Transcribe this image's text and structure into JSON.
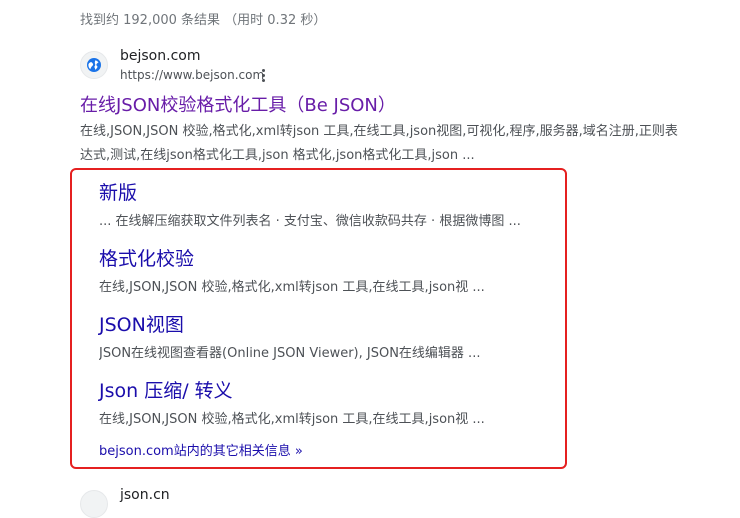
{
  "stats": "找到约 192,000 条结果 （用时 0.32 秒）",
  "result": {
    "site_name": "bejson.com",
    "url": "https://www.bejson.com",
    "favicon": "globe-icon",
    "title": "在线JSON校验格式化工具（Be JSON）",
    "snippet": "在线,JSON,JSON 校验,格式化,xml转json 工具,在线工具,json视图,可视化,程序,服务器,域名注册,正则表达式,测试,在线json格式化工具,json 格式化,json格式化工具,json ..."
  },
  "sitelinks": [
    {
      "title": "新版",
      "desc": "... 在线解压缩获取文件列表名 · 支付宝、微信收款码共存 · 根据微博图 ..."
    },
    {
      "title": "格式化校验",
      "desc": "在线,JSON,JSON 校验,格式化,xml转json 工具,在线工具,json视 ..."
    },
    {
      "title": "JSON视图",
      "desc": "JSON在线视图查看器(Online JSON Viewer), JSON在线编辑器 ..."
    },
    {
      "title": "Json 压缩/ 转义",
      "desc": "在线,JSON,JSON 校验,格式化,xml转json 工具,在线工具,json视 ..."
    }
  ],
  "more_link": "bejson.com站内的其它相关信息 »",
  "next_result": {
    "site_name": "json.cn"
  },
  "colors": {
    "visited_title": "#681da8",
    "link": "#1a0dab",
    "highlight_border": "#e52020"
  }
}
